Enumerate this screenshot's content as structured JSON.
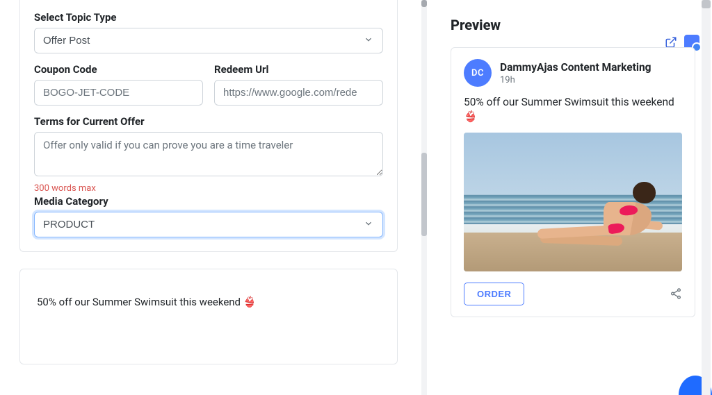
{
  "form": {
    "topic_type_label": "Select Topic Type",
    "topic_type_value": "Offer Post",
    "coupon_label": "Coupon Code",
    "coupon_placeholder": "BOGO-JET-CODE",
    "redeem_label": "Redeem Url",
    "redeem_placeholder": "https://www.google.com/rede",
    "terms_label": "Terms for Current Offer",
    "terms_placeholder": "Offer only valid if you can prove you are a time traveler",
    "terms_hint": "300 words max",
    "media_cat_label": "Media Category",
    "media_cat_value": "PRODUCT",
    "post_text": "50% off our Summer Swimsuit this weekend 👙"
  },
  "preview": {
    "heading": "Preview",
    "avatar_initials": "DC",
    "business_name": "DammyAjas Content Marketing",
    "timestamp": "19h",
    "body_text": "50% off our Summer Swimsuit this weekend 👙",
    "cta_label": "ORDER"
  }
}
